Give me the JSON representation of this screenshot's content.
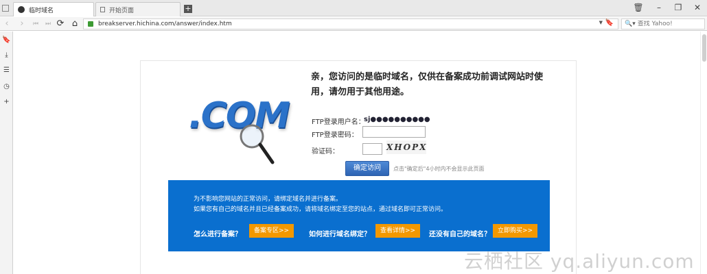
{
  "tabs": [
    {
      "label": "临时域名",
      "active": true
    },
    {
      "label": "开始页面",
      "active": false
    }
  ],
  "window": {
    "trash": "🗑",
    "minimize": "–",
    "restore": "❐",
    "close": "✕"
  },
  "nav": {
    "back": "‹",
    "forward": "›",
    "rewind": "⏮",
    "fastforward": "⏭",
    "reload": "⟳",
    "home": "⌂"
  },
  "address": {
    "url": "breakserver.hichina.com/answer/index.htm",
    "dropdown": "▼",
    "bookmark": "🔖"
  },
  "search": {
    "placeholder": "查找 Yahoo!",
    "icon": "🔍▾"
  },
  "sidebar": {
    "bookmarks": "🔖",
    "downloads": "⤓",
    "notes": "☰",
    "history": "◷",
    "add": "+"
  },
  "page": {
    "logo": ".COM",
    "headline": "亲，您访问的是临时域名，仅供在备案成功前调试网站时使用，请勿用于其他用途。",
    "ftp_user_label": "FTP登录用户名：",
    "ftp_user_value": "sj●●●●●●●●●●",
    "ftp_pwd_label": "FTP登录密码：",
    "captcha_label": "验证码：",
    "captcha_text": "XHOPX",
    "confirm_button": "确定访问",
    "confirm_hint": "点击\"确定后\"4小时内不会显示此页面",
    "info_line1": "为不影响您网站的正常访问，请绑定域名并进行备案。",
    "info_line2": "如果您有自己的域名并且已经备案成功，请将域名绑定至您的站点，通过域名即可正常访问。",
    "q1": "怎么进行备案？",
    "b1": "备案专区>>",
    "q2": "如何进行域名绑定？",
    "b2": "查看详情>>",
    "q3": "还没有自己的域名？",
    "b3": "立即购买>>"
  },
  "watermark": "云栖社区 yq.aliyun.com",
  "colors": {
    "info_bg": "#0a6fcf",
    "orange": "#f39800",
    "button_blue": "#2e64b4",
    "logo_blue": "#2b72c9"
  }
}
